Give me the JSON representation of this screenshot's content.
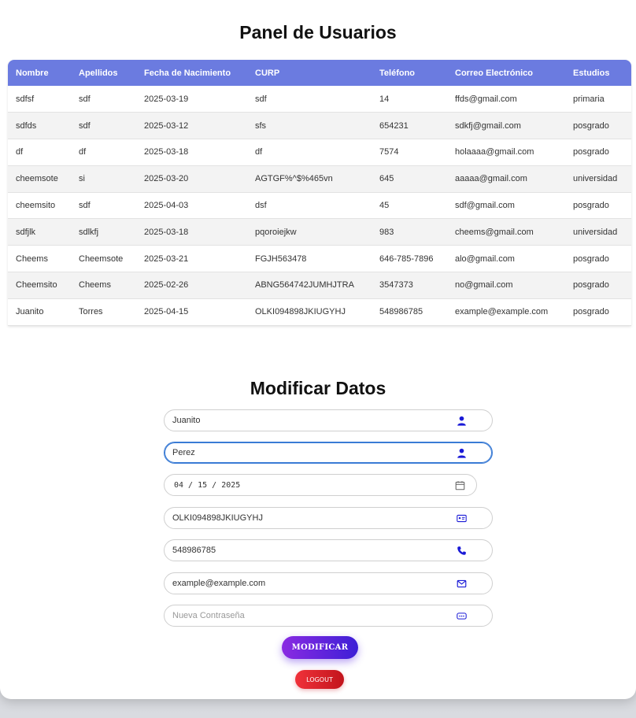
{
  "header": {
    "title": "Panel de Usuarios"
  },
  "table": {
    "columns": [
      "Nombre",
      "Apellidos",
      "Fecha de Nacimiento",
      "CURP",
      "Teléfono",
      "Correo Electrónico",
      "Estudios"
    ],
    "rows": [
      [
        "sdfsf",
        "sdf",
        "2025-03-19",
        "sdf",
        "14",
        "ffds@gmail.com",
        "primaria"
      ],
      [
        "sdfds",
        "sdf",
        "2025-03-12",
        "sfs",
        "654231",
        "sdkfj@gmail.com",
        "posgrado"
      ],
      [
        "df",
        "df",
        "2025-03-18",
        "df",
        "7574",
        "holaaaa@gmail.com",
        "posgrado"
      ],
      [
        "cheemsote",
        "si",
        "2025-03-20",
        "AGTGF%^$%465vn",
        "645",
        "aaaaa@gmail.com",
        "universidad"
      ],
      [
        "cheemsito",
        "sdf",
        "2025-04-03",
        "dsf",
        "45",
        "sdf@gmail.com",
        "posgrado"
      ],
      [
        "sdfjlk",
        "sdlkfj",
        "2025-03-18",
        "pqoroiejkw",
        "983",
        "cheems@gmail.com",
        "universidad"
      ],
      [
        "Cheems",
        "Cheemsote",
        "2025-03-21",
        "FGJH563478",
        "646-785-7896",
        "alo@gmail.com",
        "posgrado"
      ],
      [
        "Cheemsito",
        "Cheems",
        "2025-02-26",
        "ABNG564742JUMHJTRA",
        "3547373",
        "no@gmail.com",
        "posgrado"
      ],
      [
        "Juanito",
        "Torres",
        "2025-04-15",
        "OLKI094898JKIUGYHJ",
        "548986785",
        "example@example.com",
        "posgrado"
      ]
    ]
  },
  "form": {
    "title": "Modificar Datos",
    "nombre": {
      "value": "Juanito",
      "icon": "user-icon"
    },
    "apellidos": {
      "value": "Perez",
      "icon": "user-icon"
    },
    "fecha": {
      "value": "04 / 15 / 2025",
      "icon": "calendar-icon"
    },
    "curp": {
      "value": "OLKI094898JKIUGYHJ",
      "icon": "id-card-icon"
    },
    "telefono": {
      "value": "548986785",
      "icon": "phone-icon"
    },
    "correo": {
      "value": "example@example.com",
      "icon": "envelope-icon"
    },
    "password": {
      "value": "",
      "placeholder": "Nueva Contraseña",
      "icon": "password-icon"
    },
    "submit_label": "MODIFICAR",
    "logout_label": "LOGOUT"
  },
  "colors": {
    "table_header": "#6b7be0",
    "icon": "#1a1ad6",
    "primary_gradient_start": "#8a2be2",
    "primary_gradient_end": "#3d1fd6",
    "logout": "#e0242c"
  }
}
